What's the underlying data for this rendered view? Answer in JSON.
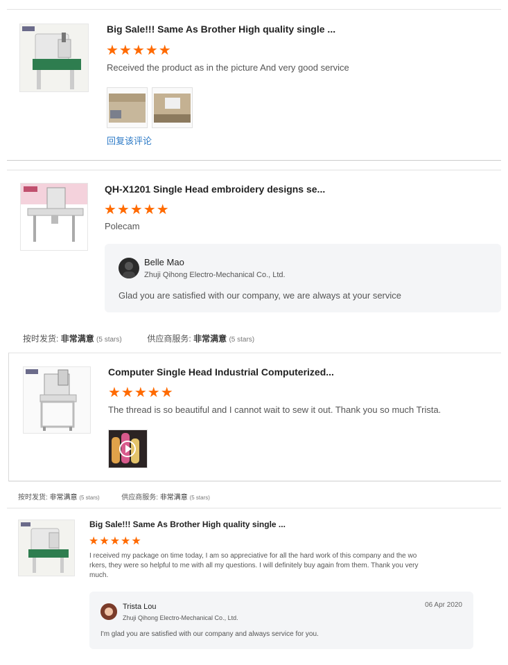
{
  "reviews": [
    {
      "product_title": "Big Sale!!! Same As Brother High quality single ...",
      "stars": "★★★★★",
      "text": "Received the product as in the picture  And very good service",
      "reply_link": "回复该评论"
    },
    {
      "product_title": "QH-X1201 Single Head embroidery designs se...",
      "stars": "★★★★★",
      "text": "Polecam",
      "reply": {
        "name": "Belle Mao",
        "company": "Zhuji Qihong Electro-Mechanical Co., Ltd.",
        "text": "Glad you are satisfied with our company, we are always at your service"
      },
      "ratings": {
        "ship_label": "按时发货:",
        "ship_value": "非常满意",
        "ship_stars": "(5 stars)",
        "service_label": "供应商服务:",
        "service_value": "非常满意",
        "service_stars": "(5 stars)"
      }
    },
    {
      "product_title": "Computer Single Head Industrial Computerized...",
      "stars": "★★★★★",
      "text": "The thread is so beautiful and I cannot wait to sew it out. Thank you so much Trista.",
      "ratings": {
        "ship_label": "按时发货:",
        "ship_value": "非常满意",
        "ship_stars": "(5 stars)",
        "service_label": "供应商服务:",
        "service_value": "非常满意",
        "service_stars": "(5 stars)"
      }
    },
    {
      "product_title": "Big Sale!!! Same As Brother High quality single ...",
      "stars": "★★★★★",
      "text_line1": "I received my package on time today, I am so appreciative for all the hard work of this company and the wo",
      "text_line2": "rkers, they were so helpful to me with all my questions. I will definitely buy again from them. Thank you very",
      "text_line3": "much.",
      "reply": {
        "name": "Trista Lou",
        "company": "Zhuji Qihong Electro-Mechanical Co., Ltd.",
        "date": "06 Apr 2020",
        "text": "I'm glad you are satisfied with our company and always service for you."
      }
    }
  ],
  "colors": {
    "star": "#ff6a00",
    "link": "#2e7bc7",
    "reply_bg": "#f4f5f7"
  },
  "icons": {
    "star": "star-icon",
    "play": "play-icon"
  }
}
